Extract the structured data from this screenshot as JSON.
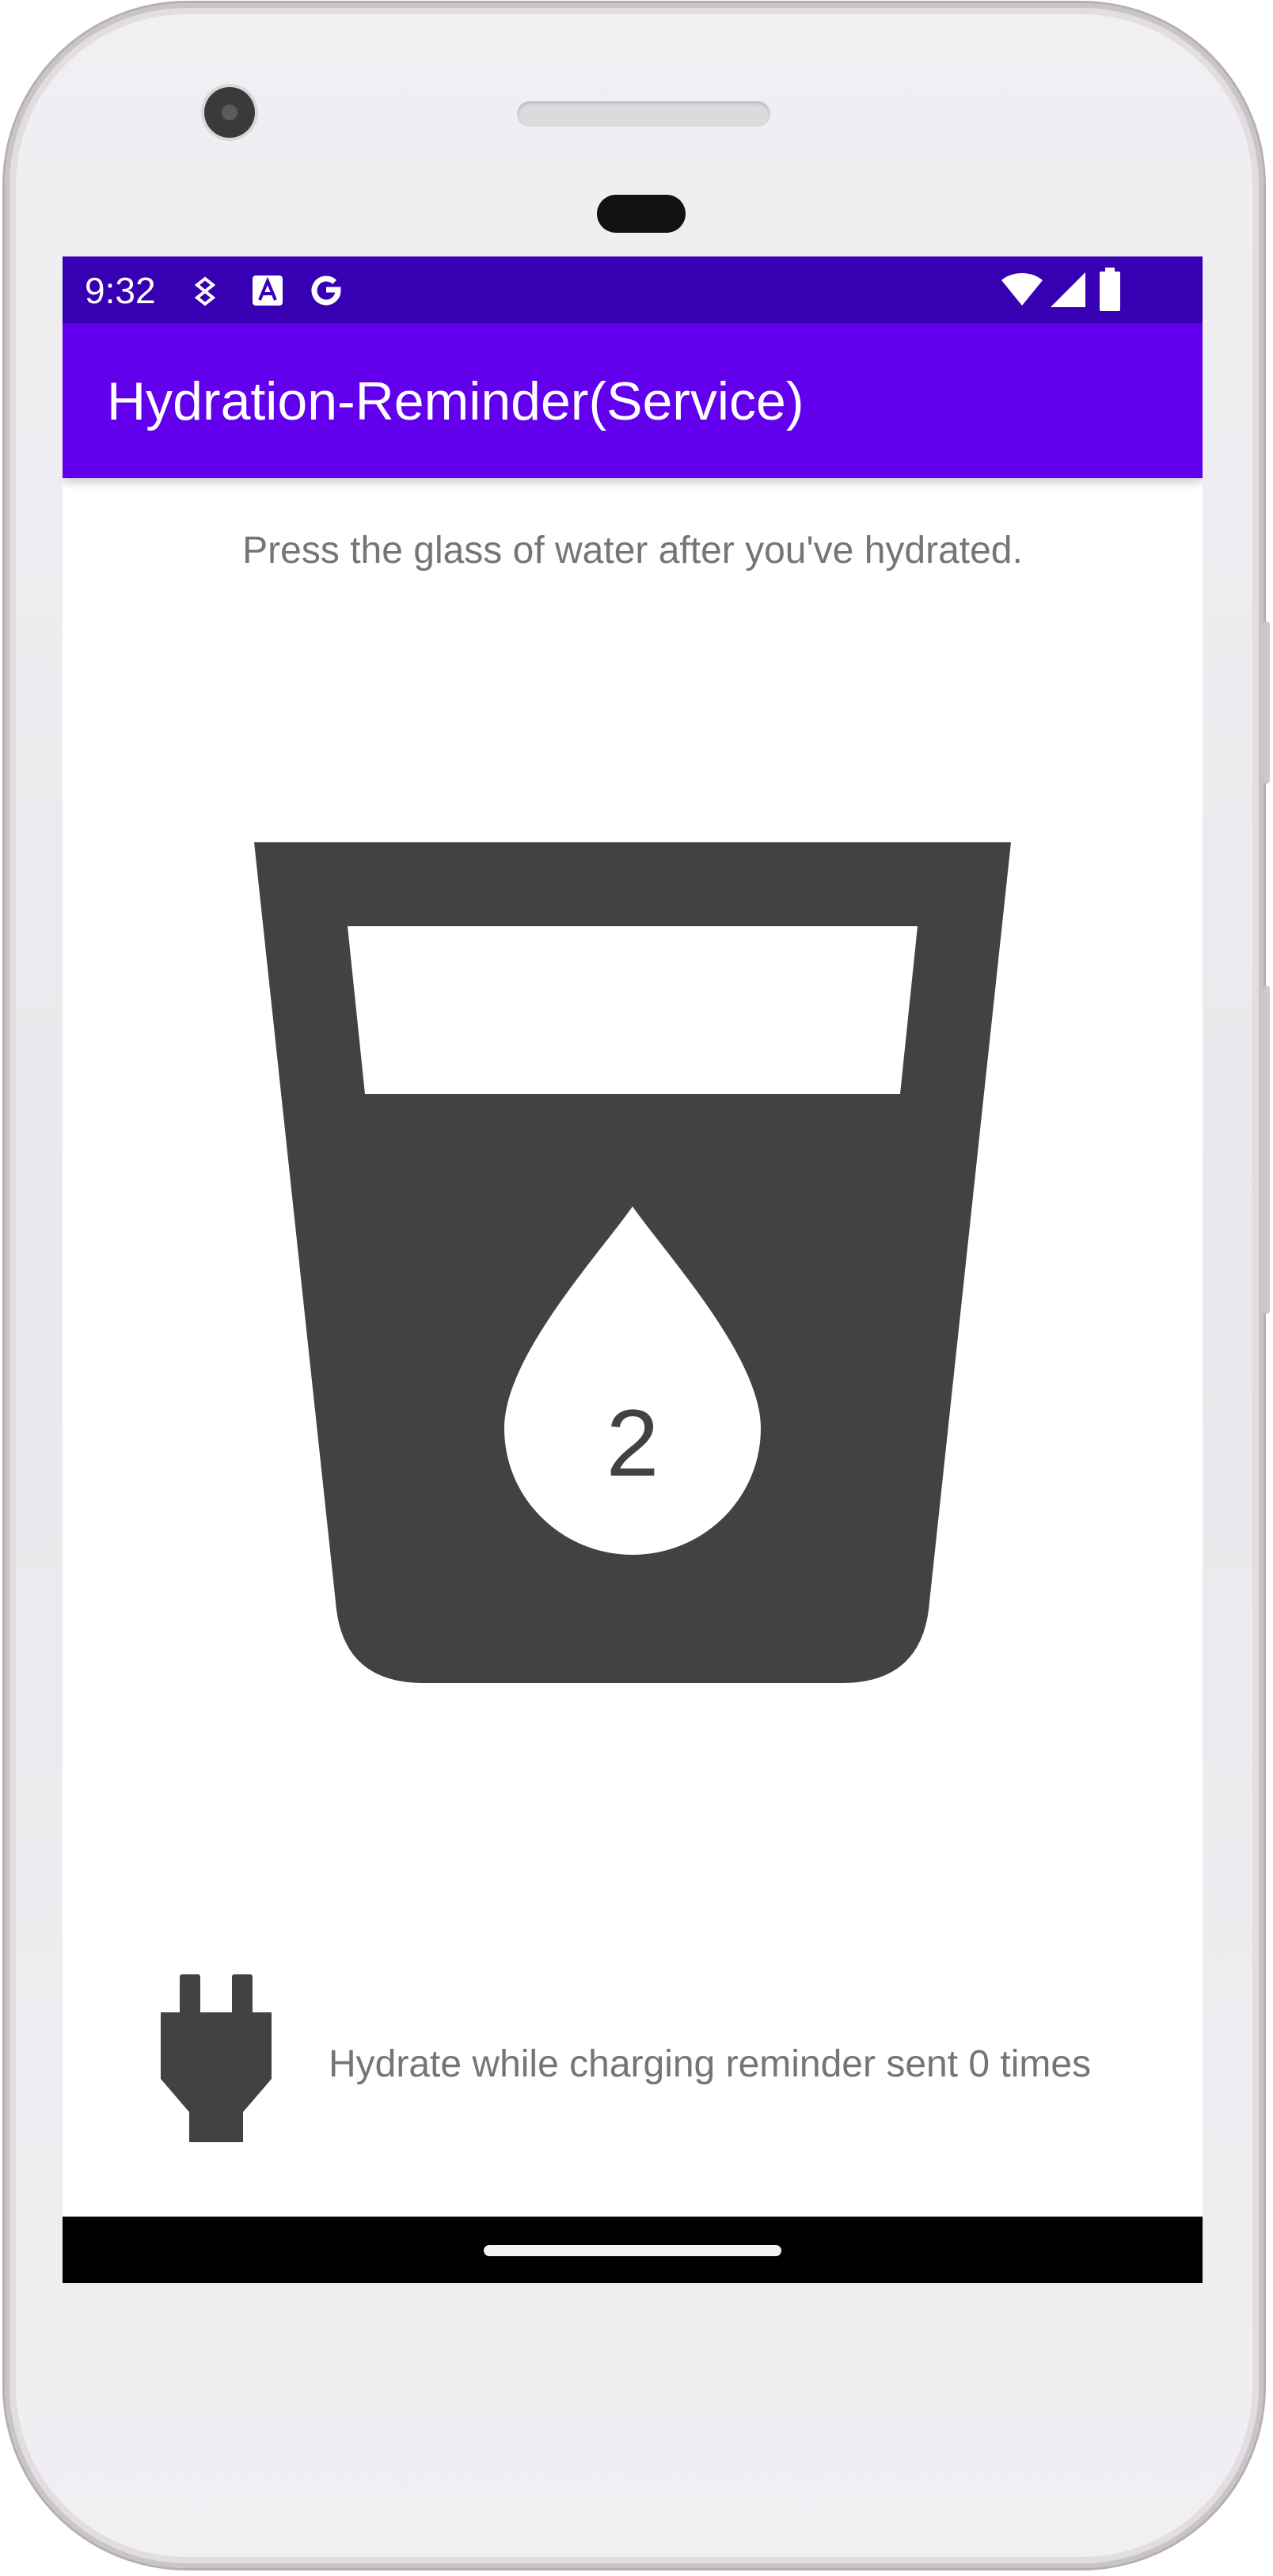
{
  "status_bar": {
    "time": "9:32",
    "left_icons": [
      "pinwheel-icon",
      "text-a-icon",
      "google-g-icon"
    ],
    "right_icons": [
      "wifi-icon",
      "cell-signal-icon",
      "battery-icon"
    ]
  },
  "app_bar": {
    "title": "Hydration-Reminder(Service)",
    "color": "#6200ee",
    "status_color": "#3700b3"
  },
  "main": {
    "instruction": "Press the glass of water after you've hydrated.",
    "glass_icon": "water-glass-icon",
    "water_count": "2",
    "icon_color": "#424242"
  },
  "charging": {
    "icon": "power-plug-icon",
    "text": "Hydrate while charging reminder sent 0 times"
  },
  "nav_bar": {
    "home_indicator": "home-pill"
  }
}
